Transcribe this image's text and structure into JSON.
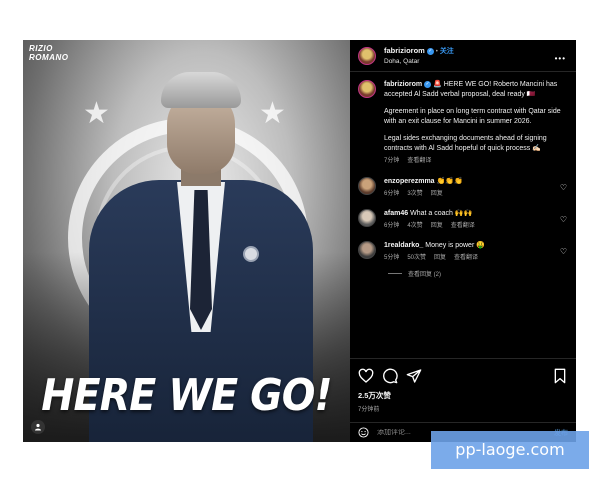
{
  "post": {
    "image": {
      "watermark": "RIZIO\nROMANO",
      "headline": "HERE WE GO!"
    },
    "header": {
      "username": "fabriziorom",
      "follow_separator": "•",
      "follow_label": "关注",
      "location": "Doha, Qatar",
      "more_icon": "more-horizontal-icon"
    },
    "caption": {
      "username": "fabriziorom",
      "line1": "🚨 HERE WE GO! Roberto Mancini has accepted Al Sadd verbal proposal, deal ready 🇶🇦",
      "line2": "Agreement in place on long term contract with Qatar side with an exit clause for Mancini in summer 2026.",
      "line3": "Legal sides exchanging documents ahead of signing contracts with Al Sadd hopeful of quick process ✍🏻",
      "time": "7分钟",
      "translate": "查看翻译"
    },
    "comments": [
      {
        "username": "enzoperezmma",
        "text": "👏👏👏",
        "time": "6分钟",
        "likes": "3次赞",
        "reply": "回复",
        "translate": ""
      },
      {
        "username": "afam46",
        "text": "What a coach 🙌🙌",
        "time": "6分钟",
        "likes": "4次赞",
        "reply": "回复",
        "translate": "查看翻译"
      },
      {
        "username": "1realdarko_",
        "text": "Money is power 🤑",
        "time": "5分钟",
        "likes": "50次赞",
        "reply": "回复",
        "translate": "查看翻译"
      }
    ],
    "view_replies": "查看回复 (2)",
    "stats": {
      "likes": "2.5万次赞",
      "ago": "7分钟前"
    },
    "comment_input": {
      "placeholder": "添加评论...",
      "post_label": "发布"
    }
  },
  "site_watermark": "pp-laoge.com",
  "colors": {
    "follow": "#3897f0",
    "verified": "#3897f0",
    "panel_bg": "#000000",
    "watermark_bg": "#6da2e8"
  }
}
